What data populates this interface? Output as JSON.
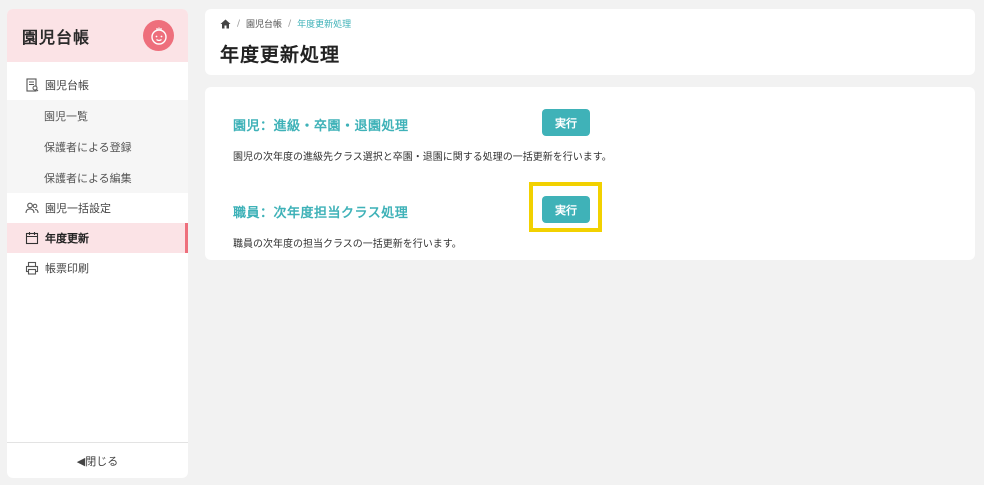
{
  "sidebar": {
    "title": "園児台帳",
    "items": [
      {
        "label": "園児台帳",
        "icon": "ledger-icon"
      },
      {
        "label": "園児一括設定",
        "icon": "users-icon"
      },
      {
        "label": "年度更新",
        "icon": "calendar-icon",
        "active": true
      },
      {
        "label": "帳票印刷",
        "icon": "printer-icon"
      }
    ],
    "sub_items": [
      "園児一覧",
      "保護者による登録",
      "保護者による編集"
    ],
    "close_label": "◀閉じる"
  },
  "breadcrumb": {
    "items": [
      "園児台帳",
      "年度更新処理"
    ]
  },
  "page": {
    "title": "年度更新処理"
  },
  "sections": [
    {
      "title": "園児：進級・卒園・退園処理",
      "description": "園児の次年度の進級先クラス選択と卒園・退園に関する処理の一括更新を行います。",
      "button_label": "実行"
    },
    {
      "title": "職員：次年度担当クラス処理",
      "description": "職員の次年度の担当クラスの一括更新を行います。",
      "button_label": "実行"
    }
  ],
  "colors": {
    "accent": "#3fb2b8",
    "brand_pink": "#ee6f7c",
    "highlight": "#f2d100"
  }
}
